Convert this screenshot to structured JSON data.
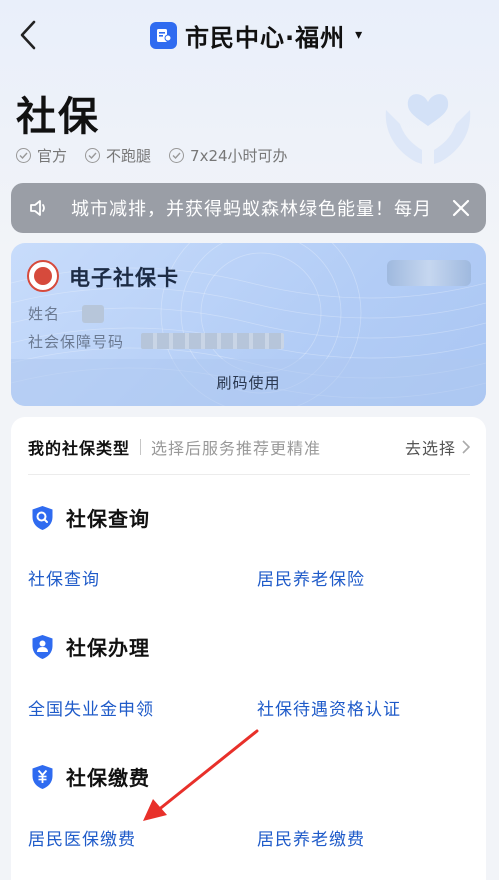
{
  "nav": {
    "title": "市民中心·福州",
    "back_icon": "chevron-left-icon",
    "logo_icon": "citizen-center-logo-icon",
    "caret_icon": "caret-down-icon",
    "caret": "▾"
  },
  "header": {
    "title": "社保",
    "tags": [
      "官方",
      "不跑腿",
      "7x24小时可办"
    ],
    "illustration": "hands-heart-icon"
  },
  "notice": {
    "text": "城市减排，并获得蚂蚁森林绿色能量！每月",
    "speaker_icon": "speaker-icon",
    "close_icon": "close-icon"
  },
  "card": {
    "title": "电子社保卡",
    "name_label": "姓名",
    "id_label": "社会保障号码",
    "action_label": "刷码使用",
    "emblem_icon": "social-security-emblem-icon"
  },
  "panel": {
    "type_label": "我的社保类型",
    "type_hint": "选择后服务推荐更精准",
    "type_action": "去选择",
    "sections": [
      {
        "title": "社保查询",
        "icon": "search-shield-icon",
        "links": [
          "社保查询",
          "居民养老保险"
        ]
      },
      {
        "title": "社保办理",
        "icon": "user-shield-icon",
        "links": [
          "全国失业金申领",
          "社保待遇资格认证"
        ]
      },
      {
        "title": "社保缴费",
        "icon": "yuan-shield-icon",
        "links": [
          "居民医保缴费",
          "居民养老缴费"
        ]
      }
    ]
  },
  "colors": {
    "accent": "#2f6bf0",
    "link": "#1f5bc9",
    "annotation_arrow": "#e8302a"
  }
}
